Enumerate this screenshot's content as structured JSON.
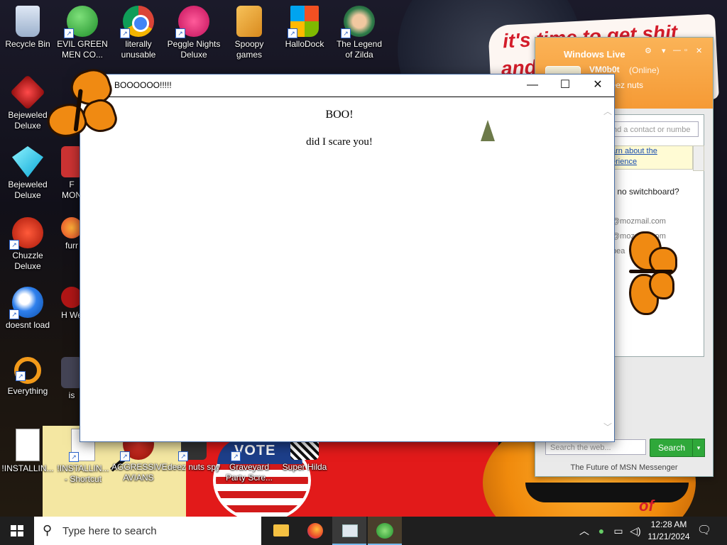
{
  "desktop_icons": [
    {
      "label": "Recycle Bin",
      "icon": "recycle-bin-icon"
    },
    {
      "label": "EVIL GREEN MEN CO...",
      "icon": "green-men-icon"
    },
    {
      "label": "literally unusable",
      "icon": "chrome-icon"
    },
    {
      "label": "Peggle Nights Deluxe",
      "icon": "peggle-icon"
    },
    {
      "label": "Spoopy games",
      "icon": "folder-icon"
    },
    {
      "label": "HalloDock",
      "icon": "windows-logo-icon"
    },
    {
      "label": "The Legend of Zilda",
      "icon": "zilda-icon"
    },
    {
      "label": "Bejeweled Deluxe",
      "icon": "bejeweled-2-icon"
    },
    {
      "label": "Bejeweled Deluxe",
      "icon": "bejeweled-icon"
    },
    {
      "label": "Chuzzle Deluxe",
      "icon": "chuzzle-icon"
    },
    {
      "label": "doesnt load",
      "icon": "thunderbird-icon"
    },
    {
      "label": "Everything",
      "icon": "everything-search-icon"
    },
    {
      "label": "!INSTALLIN...",
      "icon": "text-file-icon"
    },
    {
      "label": "!INSTALLIN... - Shortcut",
      "icon": "text-file-shortcut-icon"
    },
    {
      "label": "AGGRESSIVE AVIANS",
      "icon": "angry-bird-icon"
    },
    {
      "label": "deez nuts spy",
      "icon": "spy-icon"
    },
    {
      "label": "Graveyard Party Scre...",
      "icon": "graveyard-icon"
    },
    {
      "label": "Super Hilda",
      "icon": "super-hilda-icon"
    },
    {
      "label": "F MON",
      "icon": "generic-app-icon"
    },
    {
      "label": "furr",
      "icon": "firefox-icon"
    },
    {
      "label": "H We",
      "icon": "generic-red-icon"
    },
    {
      "label": "is",
      "icon": "generic-dark-icon"
    }
  ],
  "wallpaper": {
    "graffiti_line1": "it's time to get shit",
    "graffiti_line2": "and",
    "sign_text": "VOTE",
    "corner_tag": "of"
  },
  "window": {
    "title": "BOOOOOO!!!!!",
    "minimize": "—",
    "maximize": "☐",
    "close": "✕",
    "heading": "BOO!",
    "message": "did I scare you!"
  },
  "msn": {
    "brand": "Windows Live",
    "user_name": "VM0b0t",
    "status": "(Online)",
    "personal_message": "rate deez nuts",
    "search_contact_placeholder": "nd a contact or numbe",
    "tip_line1": "arn about the",
    "tip_line2": "erience",
    "switchboard_text": "- no switchboard?",
    "email1": "@mozmail.com",
    "email2": "@mozmail.com",
    "extra_text": "bea",
    "web_search_placeholder": "Search the web...",
    "search_button": "Search",
    "footer": "The Future of MSN Messenger"
  },
  "taskbar": {
    "search_placeholder": "Type here to search",
    "apps": [
      "file-explorer-icon",
      "firefox-icon",
      "boo-window-icon",
      "msn-messenger-icon"
    ],
    "time": "12:28 AM",
    "date": "11/21/2024"
  },
  "colors": {
    "msn_orange": "#f59a35",
    "search_green": "#2fa83a",
    "taskbar": "#1f1f1f",
    "butterfly": "#f08a12"
  }
}
